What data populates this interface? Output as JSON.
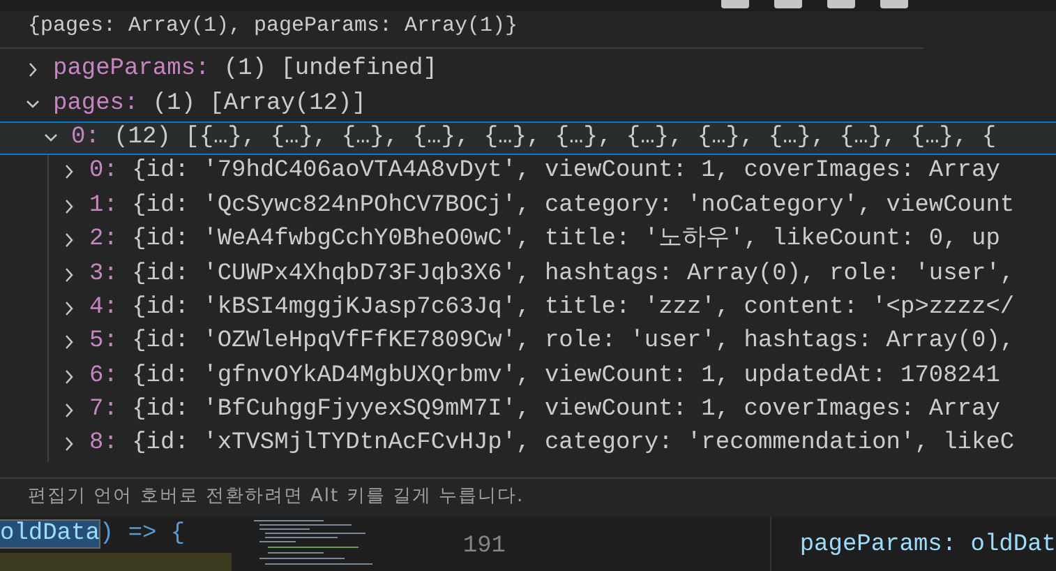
{
  "hover": {
    "header": "{pages: Array(1), pageParams: Array(1)}",
    "items": [
      {
        "key": "pageParams:",
        "value": "(1) [undefined]",
        "expanded": false,
        "selected": false
      },
      {
        "key": "pages:",
        "value": "(1) [Array(12)]",
        "expanded": true,
        "selected": false,
        "children": [
          {
            "key": "0:",
            "value": "(12) [{…}, {…}, {…}, {…}, {…}, {…}, {…}, {…}, {…}, {…}, {…}, {",
            "expanded": true,
            "selected": true,
            "children": [
              {
                "key": "0:",
                "value": "{id: '79hdC406aoVTA4A8vDyt', viewCount: 1, coverImages: Array",
                "expanded": false,
                "selected": false
              },
              {
                "key": "1:",
                "value": "{id: 'QcSywc824nPOhCV7BOCj', category: 'noCategory', viewCount",
                "expanded": false,
                "selected": false
              },
              {
                "key": "2:",
                "value": "{id: 'WeA4fwbgCchY0BheO0wC', title: '노하우', likeCount: 0, up",
                "expanded": false,
                "selected": false
              },
              {
                "key": "3:",
                "value": "{id: 'CUWPx4XhqbD73FJqb3X6', hashtags: Array(0), role: 'user',",
                "expanded": false,
                "selected": false
              },
              {
                "key": "4:",
                "value": "{id: 'kBSI4mggjKJasp7c63Jq', title: 'zzz', content: '<p>zzzz</",
                "expanded": false,
                "selected": false
              },
              {
                "key": "5:",
                "value": "{id: 'OZWleHpqVfFfKE7809Cw', role: 'user', hashtags: Array(0),",
                "expanded": false,
                "selected": false
              },
              {
                "key": "6:",
                "value": "{id: 'gfnvOYkAD4MgbUXQrbmv', viewCount: 1, updatedAt: 1708241",
                "expanded": false,
                "selected": false
              },
              {
                "key": "7:",
                "value": "{id: 'BfCuhggFjyyexSQ9mM7I', viewCount: 1, coverImages: Array",
                "expanded": false,
                "selected": false
              },
              {
                "key": "8:",
                "value": "{id: 'xTVSMjlTYDtnAcFCvHJp', category: 'recommendation', likeC",
                "expanded": false,
                "selected": false
              }
            ]
          }
        ]
      }
    ],
    "hint": "편집기 언어 호버로 전환하려면 Alt 키를 길게 누릅니다."
  },
  "editor": {
    "left_code_selected": "oldData",
    "left_code_rest": ") => {",
    "line_number": "191",
    "right_code": "pageParams: oldDat"
  }
}
